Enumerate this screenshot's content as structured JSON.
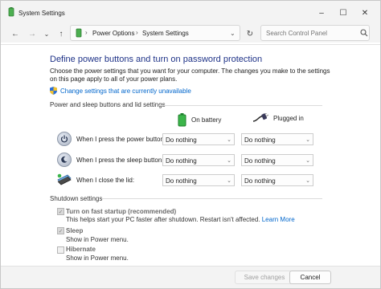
{
  "window": {
    "title": "System Settings"
  },
  "address": {
    "crumbs": [
      "Power Options",
      "System Settings"
    ],
    "search_placeholder": "Search Control Panel"
  },
  "content": {
    "heading": "Define power buttons and turn on password protection",
    "description": "Choose the power settings that you want for your computer. The changes you make to the settings on this page apply to all of your power plans.",
    "change_link": "Change settings that are currently unavailable",
    "section_power": "Power and sleep buttons and lid settings",
    "col_battery": "On battery",
    "col_plugged": "Plugged in",
    "rows": [
      {
        "label": "When I press the power button:",
        "battery": "Do nothing",
        "plugged": "Do nothing"
      },
      {
        "label": "When I press the sleep button:",
        "battery": "Do nothing",
        "plugged": "Do nothing"
      },
      {
        "label": "When I close the lid:",
        "battery": "Do nothing",
        "plugged": "Do nothing"
      }
    ],
    "section_shutdown": "Shutdown settings",
    "fast_startup": {
      "title": "Turn on fast startup (recommended)",
      "desc": "This helps start your PC faster after shutdown. Restart isn't affected.",
      "learn_more": "Learn More"
    },
    "sleep": {
      "title": "Sleep",
      "desc": "Show in Power menu."
    },
    "hibernate": {
      "title": "Hibernate",
      "desc": "Show in Power menu."
    }
  },
  "footer": {
    "save": "Save changes",
    "cancel": "Cancel"
  }
}
